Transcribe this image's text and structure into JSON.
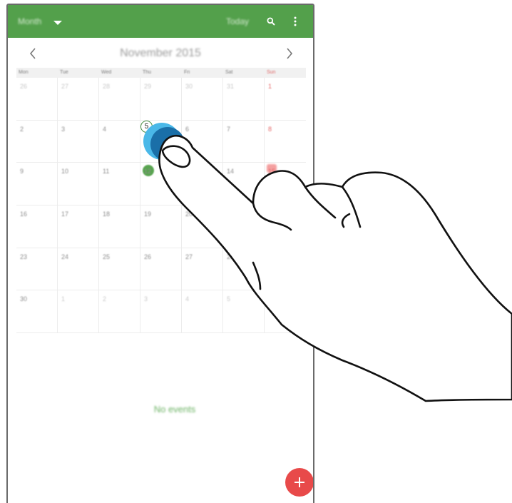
{
  "app": {
    "view_selector": "Month",
    "today_label": "Today",
    "icons": {
      "search": "search-icon",
      "more": "more-vert-icon",
      "prev": "chevron-left-icon",
      "next": "chevron-right-icon",
      "add": "plus-icon"
    },
    "colors": {
      "appbar": "#53a04b",
      "today_dot": "#58a44f",
      "sunday": "#e66b6b",
      "fab": "#e84a4a",
      "tap": "#4ab8e8"
    }
  },
  "calendar": {
    "month_title": "November 2015",
    "weekdays": [
      "Mon",
      "Tue",
      "Wed",
      "Thu",
      "Fri",
      "Sat",
      "Sun"
    ],
    "days": [
      "26",
      "27",
      "28",
      "29",
      "30",
      "31",
      "1",
      "2",
      "3",
      "4",
      "5",
      "6",
      "7",
      "8",
      "9",
      "10",
      "11",
      "12",
      "13",
      "14",
      "15",
      "16",
      "17",
      "18",
      "19",
      "20",
      "21",
      "22",
      "23",
      "24",
      "25",
      "26",
      "27",
      "28",
      "29",
      "30",
      "1",
      "2",
      "3",
      "4",
      "5",
      "6"
    ],
    "selected_day": "5"
  },
  "events": {
    "empty_label": "No events"
  }
}
